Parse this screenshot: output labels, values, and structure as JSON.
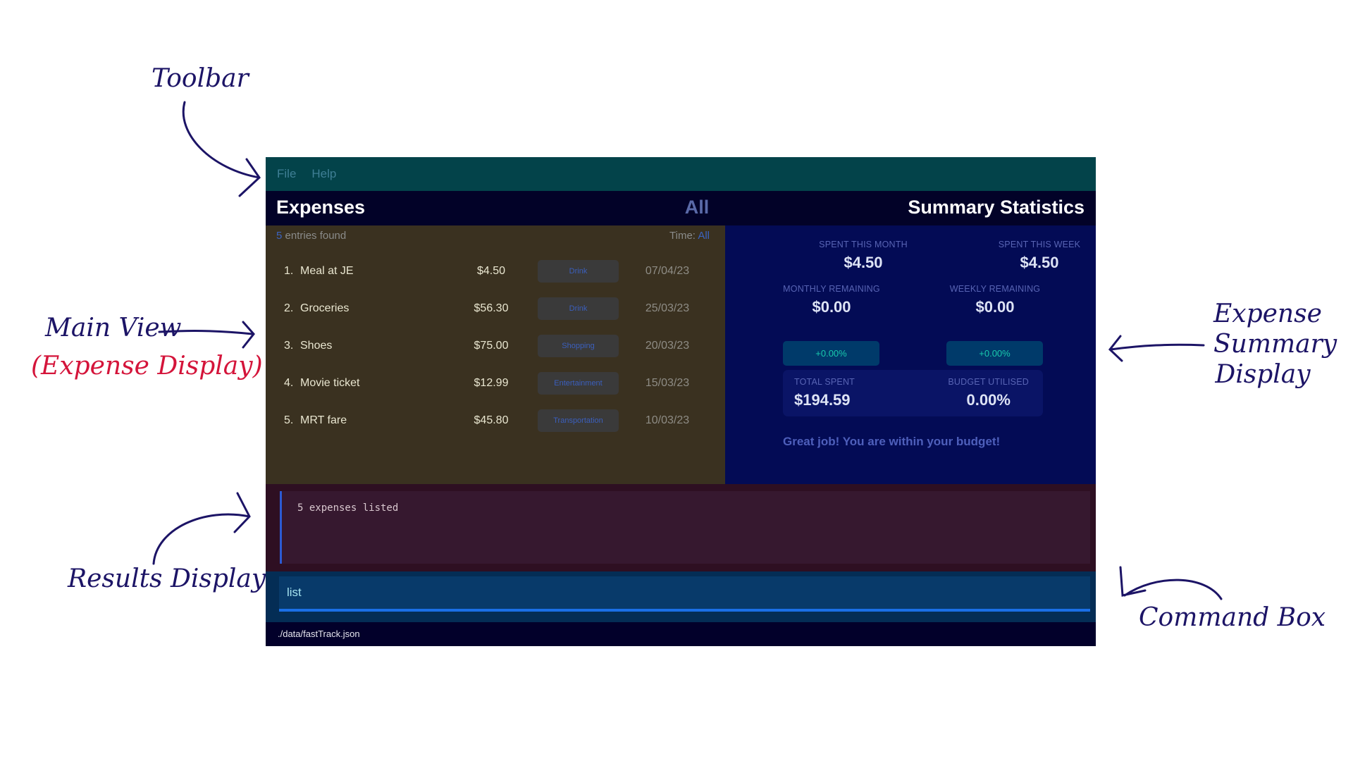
{
  "annotations": {
    "toolbar": "Toolbar",
    "main_view": "Main View",
    "main_view_sub": "(Expense Display)",
    "results_display": "Results Display",
    "summary_line1": "Expense",
    "summary_line2": "Summary",
    "summary_line3": "Display",
    "command_box": "Command Box"
  },
  "toolbar": {
    "menus": [
      "File",
      "Help"
    ]
  },
  "header": {
    "expenses_title": "Expenses",
    "filter_label": "All",
    "summary_title": "Summary Statistics"
  },
  "expense_list": {
    "count": "5",
    "count_suffix": " entries found",
    "time_label": "Time: ",
    "time_value": "All",
    "items": [
      {
        "index": "1.",
        "name": "Meal at JE",
        "price": "$4.50",
        "category": "Drink",
        "date": "07/04/23"
      },
      {
        "index": "2.",
        "name": "Groceries",
        "price": "$56.30",
        "category": "Drink",
        "date": "25/03/23"
      },
      {
        "index": "3.",
        "name": "Shoes",
        "price": "$75.00",
        "category": "Shopping",
        "date": "20/03/23"
      },
      {
        "index": "4.",
        "name": "Movie ticket",
        "price": "$12.99",
        "category": "Entertainment",
        "date": "15/03/23"
      },
      {
        "index": "5.",
        "name": "MRT fare",
        "price": "$45.80",
        "category": "Transportation",
        "date": "10/03/23"
      }
    ]
  },
  "summary": {
    "spent_month_label": "SPENT THIS MONTH",
    "spent_month": "$4.50",
    "spent_week_label": "SPENT THIS WEEK",
    "spent_week": "$4.50",
    "monthly_remaining_label": "MONTHLY REMAINING",
    "monthly_remaining": "$0.00",
    "weekly_remaining_label": "WEEKLY REMAINING",
    "weekly_remaining": "$0.00",
    "monthly_change": "+0.00%",
    "weekly_change": "+0.00%",
    "total_spent_label": "TOTAL SPENT",
    "total_spent": "$194.59",
    "budget_utilised_label": "BUDGET UTILISED",
    "budget_utilised": "0.00%",
    "message": "Great job! You are within your budget!"
  },
  "results": {
    "text": "5 expenses listed"
  },
  "command": {
    "value": "list"
  },
  "status_bar": {
    "path": "./data/fastTrack.json"
  },
  "colors": {
    "toolbar": "#03434a",
    "header": "#020228",
    "expense_panel": "#3a3120",
    "summary_panel": "#030b55",
    "results": "#2e0f22",
    "command": "#042d55",
    "annotation": "#1c1466",
    "annotation_red": "#d4143a"
  }
}
